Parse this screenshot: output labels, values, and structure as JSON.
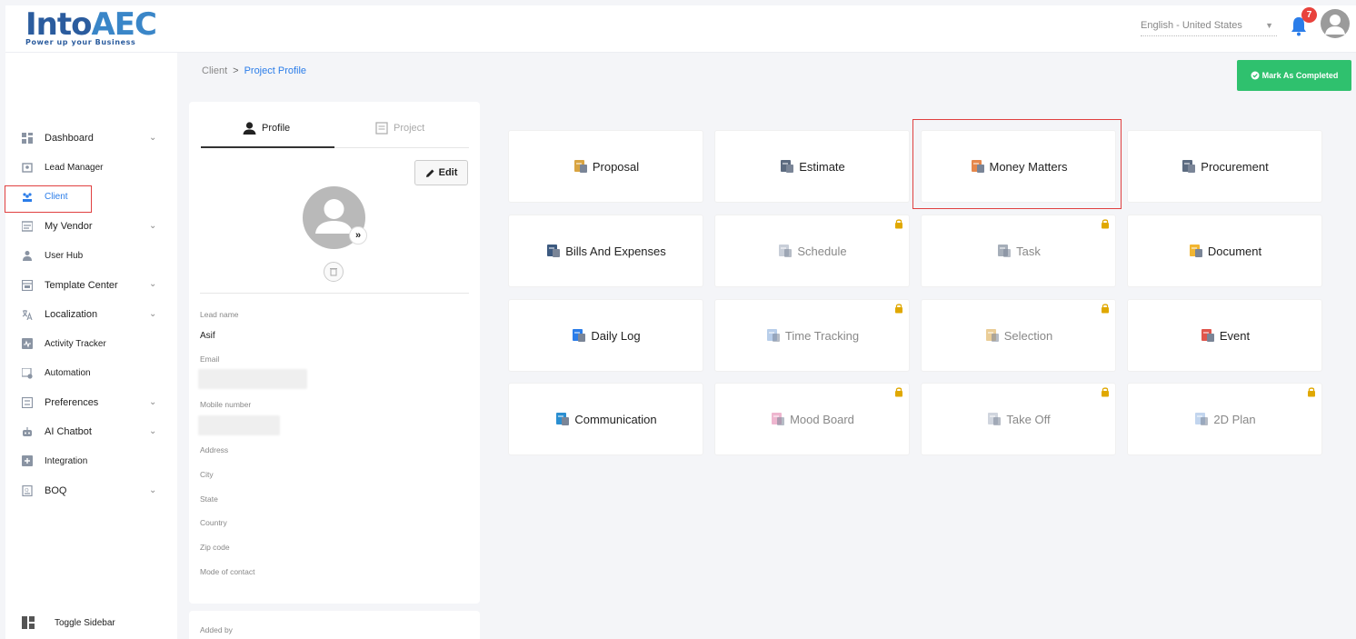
{
  "header": {
    "logo_main": "Into",
    "logo_accent": "AEC",
    "logo_tagline": "Power up your Business",
    "language": "English - United States",
    "notification_count": "7"
  },
  "sidebar": {
    "items": [
      {
        "label": "Dashboard",
        "icon": "dashboard-icon",
        "expandable": true
      },
      {
        "label": "Lead Manager",
        "icon": "lead-manager-icon",
        "expandable": false
      },
      {
        "label": "Client",
        "icon": "client-icon",
        "expandable": false,
        "active": true
      },
      {
        "label": "My Vendor",
        "icon": "vendor-icon",
        "expandable": true
      },
      {
        "label": "User Hub",
        "icon": "user-hub-icon",
        "expandable": false
      },
      {
        "label": "Template Center",
        "icon": "template-icon",
        "expandable": true
      },
      {
        "label": "Localization",
        "icon": "localization-icon",
        "expandable": true
      },
      {
        "label": "Activity Tracker",
        "icon": "activity-icon",
        "expandable": false
      },
      {
        "label": "Automation",
        "icon": "automation-icon",
        "expandable": false
      },
      {
        "label": "Preferences",
        "icon": "preferences-icon",
        "expandable": true
      },
      {
        "label": "AI Chatbot",
        "icon": "chatbot-icon",
        "expandable": true
      },
      {
        "label": "Integration",
        "icon": "integration-icon",
        "expandable": false
      },
      {
        "label": "BOQ",
        "icon": "boq-icon",
        "expandable": true
      }
    ],
    "toggle_label": "Toggle Sidebar"
  },
  "breadcrumb": {
    "root": "Client",
    "current": "Project Profile"
  },
  "actions": {
    "mark_completed": "Mark As Completed"
  },
  "profile_card": {
    "tab_profile": "Profile",
    "tab_project": "Project",
    "edit_label": "Edit",
    "fields": {
      "lead_name_label": "Lead name",
      "lead_name_value": "Asif",
      "email_label": "Email",
      "mobile_label": "Mobile number",
      "address_label": "Address",
      "city_label": "City",
      "state_label": "State",
      "country_label": "Country",
      "zip_label": "Zip code",
      "mode_label": "Mode of contact"
    },
    "added_by_label": "Added by"
  },
  "modules": [
    {
      "label": "Proposal",
      "locked": false,
      "icon": "proposal-icon",
      "color": "#d9a441"
    },
    {
      "label": "Estimate",
      "locked": false,
      "icon": "estimate-icon",
      "color": "#5c6b80"
    },
    {
      "label": "Money Matters",
      "locked": false,
      "icon": "money-matters-icon",
      "color": "#e6874b"
    },
    {
      "label": "Procurement",
      "locked": false,
      "icon": "procurement-icon",
      "color": "#5c6b80"
    },
    {
      "label": "Bills And Expenses",
      "locked": false,
      "icon": "bills-icon",
      "color": "#3d5a80"
    },
    {
      "label": "Schedule",
      "locked": true,
      "icon": "schedule-icon",
      "color": "#9aa5b8"
    },
    {
      "label": "Task",
      "locked": true,
      "icon": "task-icon",
      "color": "#5c6b80"
    },
    {
      "label": "Document",
      "locked": false,
      "icon": "document-icon",
      "color": "#f2b632"
    },
    {
      "label": "Daily Log",
      "locked": false,
      "icon": "daily-log-icon",
      "color": "#2b7de9"
    },
    {
      "label": "Time Tracking",
      "locked": true,
      "icon": "time-tracking-icon",
      "color": "#7ea6d8"
    },
    {
      "label": "Selection",
      "locked": true,
      "icon": "selection-icon",
      "color": "#d9a441"
    },
    {
      "label": "Event",
      "locked": false,
      "icon": "event-icon",
      "color": "#e0564c"
    },
    {
      "label": "Communication",
      "locked": false,
      "icon": "communication-icon",
      "color": "#2b8fd1"
    },
    {
      "label": "Mood Board",
      "locked": true,
      "icon": "mood-board-icon",
      "color": "#e07aa8"
    },
    {
      "label": "Take Off",
      "locked": true,
      "icon": "take-off-icon",
      "color": "#a9b3c2"
    },
    {
      "label": "2D Plan",
      "locked": true,
      "icon": "2d-plan-icon",
      "color": "#8fb3e0"
    }
  ],
  "colors": {
    "accent_blue": "#2b7de9",
    "success_green": "#2fc16e",
    "highlight_red": "#e04040",
    "lock_gold": "#e0a800"
  }
}
